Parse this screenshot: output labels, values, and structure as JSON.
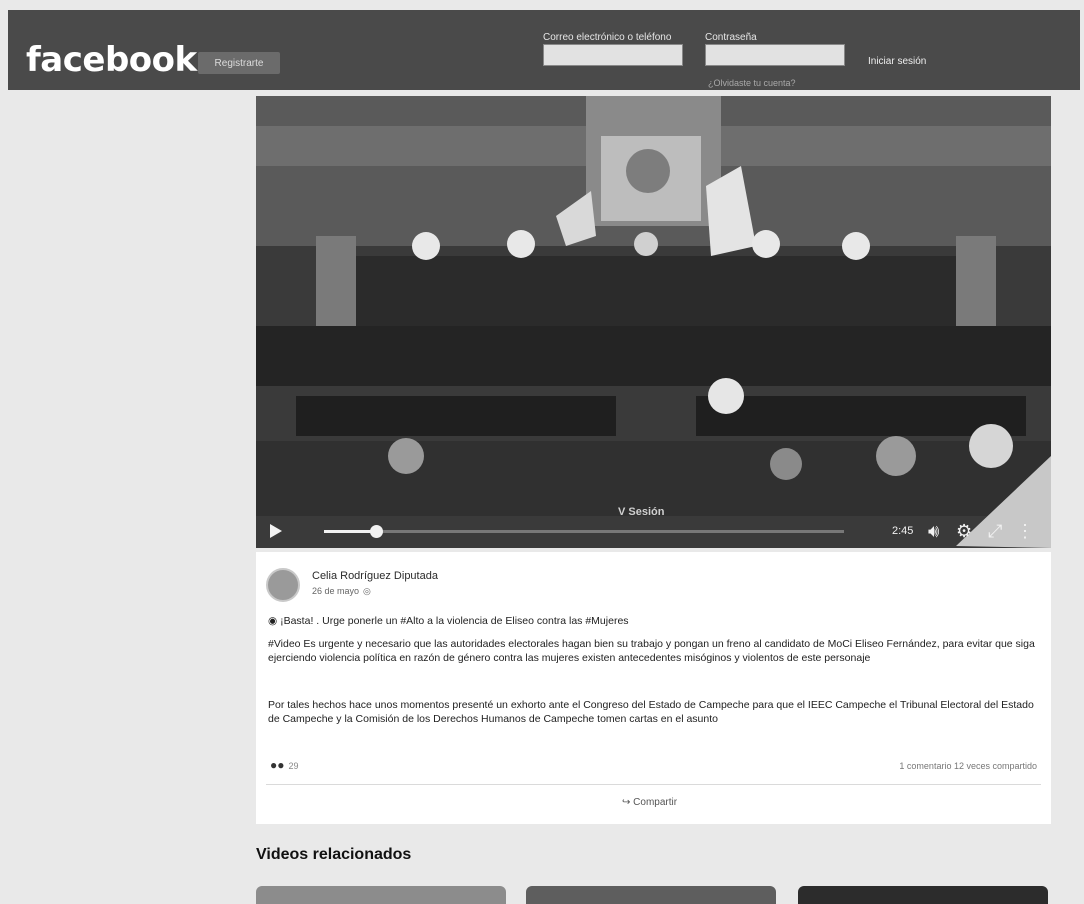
{
  "header": {
    "logo": "facebook",
    "register_label": "Registrarte",
    "email_label": "Correo electrónico o teléfono",
    "password_label": "Contraseña",
    "login_label": "Iniciar sesión",
    "forgot_label": "¿Olvidaste tu cuenta?"
  },
  "video": {
    "title": "V Sesión",
    "time_remaining": "2:45",
    "progress": 0.1
  },
  "post": {
    "author": "Celia Rodríguez Diputada",
    "date": "26 de mayo",
    "headline": "¡Basta! . Urge ponerle un #Alto a la violencia de Eliseo contra las #Mujeres",
    "para1": "#Video  Es urgente y necesario que las autoridades electorales hagan bien su trabajo y pongan un freno al candidato de MoCi Eliseo Fernández, para evitar que siga ejerciendo violencia política en razón de género contra las mujeres  existen antecedentes misóginos y violentos de este personaje",
    "para2": "Por tales hechos  hace unos momentos presenté un exhorto ante el Congreso del Estado de Campeche para que el IEEC Campeche  el Tribunal Electoral del Estado de Campeche y la Comisión de los Derechos Humanos de Campeche tomen cartas en el asunto",
    "reaction_count": "29",
    "stats": "1 comentario  12 veces compartido",
    "share_label": "Compartir"
  },
  "related": {
    "title": "Videos relacionados"
  }
}
